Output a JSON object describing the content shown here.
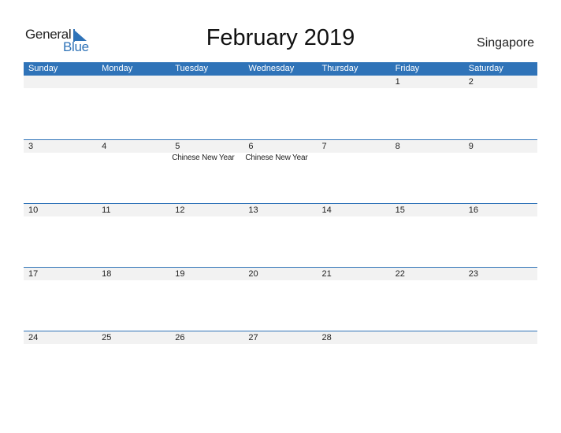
{
  "logo": {
    "line1": "General",
    "line2": "Blue",
    "brand_color": "#2f73b8"
  },
  "title": "February 2019",
  "country": "Singapore",
  "header_color": "#2f73b8",
  "weekdays": [
    "Sunday",
    "Monday",
    "Tuesday",
    "Wednesday",
    "Thursday",
    "Friday",
    "Saturday"
  ],
  "weeks": [
    {
      "days": [
        {
          "num": "",
          "event": ""
        },
        {
          "num": "",
          "event": ""
        },
        {
          "num": "",
          "event": ""
        },
        {
          "num": "",
          "event": ""
        },
        {
          "num": "",
          "event": ""
        },
        {
          "num": "1",
          "event": ""
        },
        {
          "num": "2",
          "event": ""
        }
      ]
    },
    {
      "days": [
        {
          "num": "3",
          "event": ""
        },
        {
          "num": "4",
          "event": ""
        },
        {
          "num": "5",
          "event": "Chinese New Year"
        },
        {
          "num": "6",
          "event": "Chinese New Year"
        },
        {
          "num": "7",
          "event": ""
        },
        {
          "num": "8",
          "event": ""
        },
        {
          "num": "9",
          "event": ""
        }
      ]
    },
    {
      "days": [
        {
          "num": "10",
          "event": ""
        },
        {
          "num": "11",
          "event": ""
        },
        {
          "num": "12",
          "event": ""
        },
        {
          "num": "13",
          "event": ""
        },
        {
          "num": "14",
          "event": ""
        },
        {
          "num": "15",
          "event": ""
        },
        {
          "num": "16",
          "event": ""
        }
      ]
    },
    {
      "days": [
        {
          "num": "17",
          "event": ""
        },
        {
          "num": "18",
          "event": ""
        },
        {
          "num": "19",
          "event": ""
        },
        {
          "num": "20",
          "event": ""
        },
        {
          "num": "21",
          "event": ""
        },
        {
          "num": "22",
          "event": ""
        },
        {
          "num": "23",
          "event": ""
        }
      ]
    },
    {
      "days": [
        {
          "num": "24",
          "event": ""
        },
        {
          "num": "25",
          "event": ""
        },
        {
          "num": "26",
          "event": ""
        },
        {
          "num": "27",
          "event": ""
        },
        {
          "num": "28",
          "event": ""
        },
        {
          "num": "",
          "event": ""
        },
        {
          "num": "",
          "event": ""
        }
      ]
    }
  ]
}
